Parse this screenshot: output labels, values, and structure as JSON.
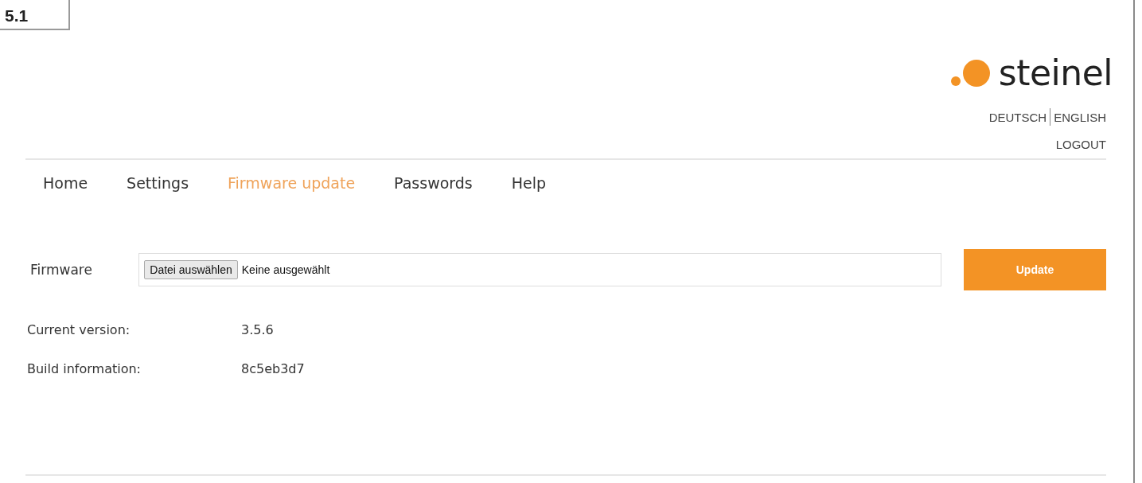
{
  "section_label": "5.1",
  "logo": {
    "text": "steinel"
  },
  "languages": [
    "DEUTSCH",
    "ENGLISH"
  ],
  "logout": "LOGOUT",
  "tabs": [
    {
      "label": "Home",
      "selected": false
    },
    {
      "label": "Settings",
      "selected": false
    },
    {
      "label": "Firmware update",
      "selected": true
    },
    {
      "label": "Passwords",
      "selected": false
    },
    {
      "label": "Help",
      "selected": false
    }
  ],
  "firmware": {
    "label": "Firmware",
    "file_button": "Datei auswählen",
    "file_status": "Keine ausgewählt",
    "update_button": "Update"
  },
  "info": [
    {
      "label": "Current version:",
      "value": "3.5.6"
    },
    {
      "label": "Build information:",
      "value": "8c5eb3d7"
    }
  ]
}
